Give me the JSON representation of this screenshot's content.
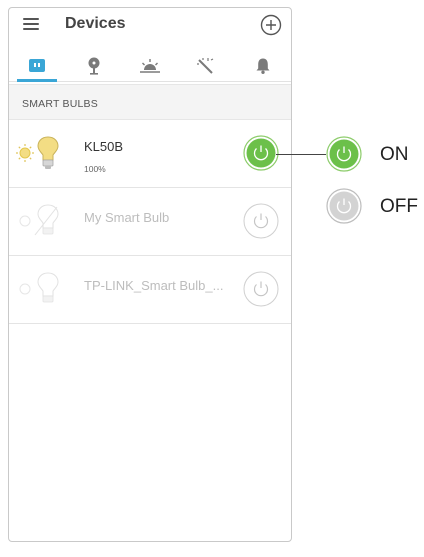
{
  "header": {
    "title": "Devices"
  },
  "section": {
    "label": "SMART BULBS"
  },
  "devices": [
    {
      "name": "KL50B",
      "brightness": "100%",
      "state": "on"
    },
    {
      "name": "My Smart Bulb",
      "state": "offline"
    },
    {
      "name": "TP-LINK_Smart Bulb_...",
      "state": "offline"
    }
  ],
  "legend": {
    "on_label": "ON",
    "off_label": "OFF"
  },
  "colors": {
    "on_green": "#6cc04a",
    "accent": "#3aa6d6",
    "bulb_yellow": "#f3dd84"
  },
  "icons": {
    "tabs": [
      "plug-icon",
      "lamp-icon",
      "sunrise-icon",
      "magic-wand-icon",
      "bell-icon"
    ]
  }
}
